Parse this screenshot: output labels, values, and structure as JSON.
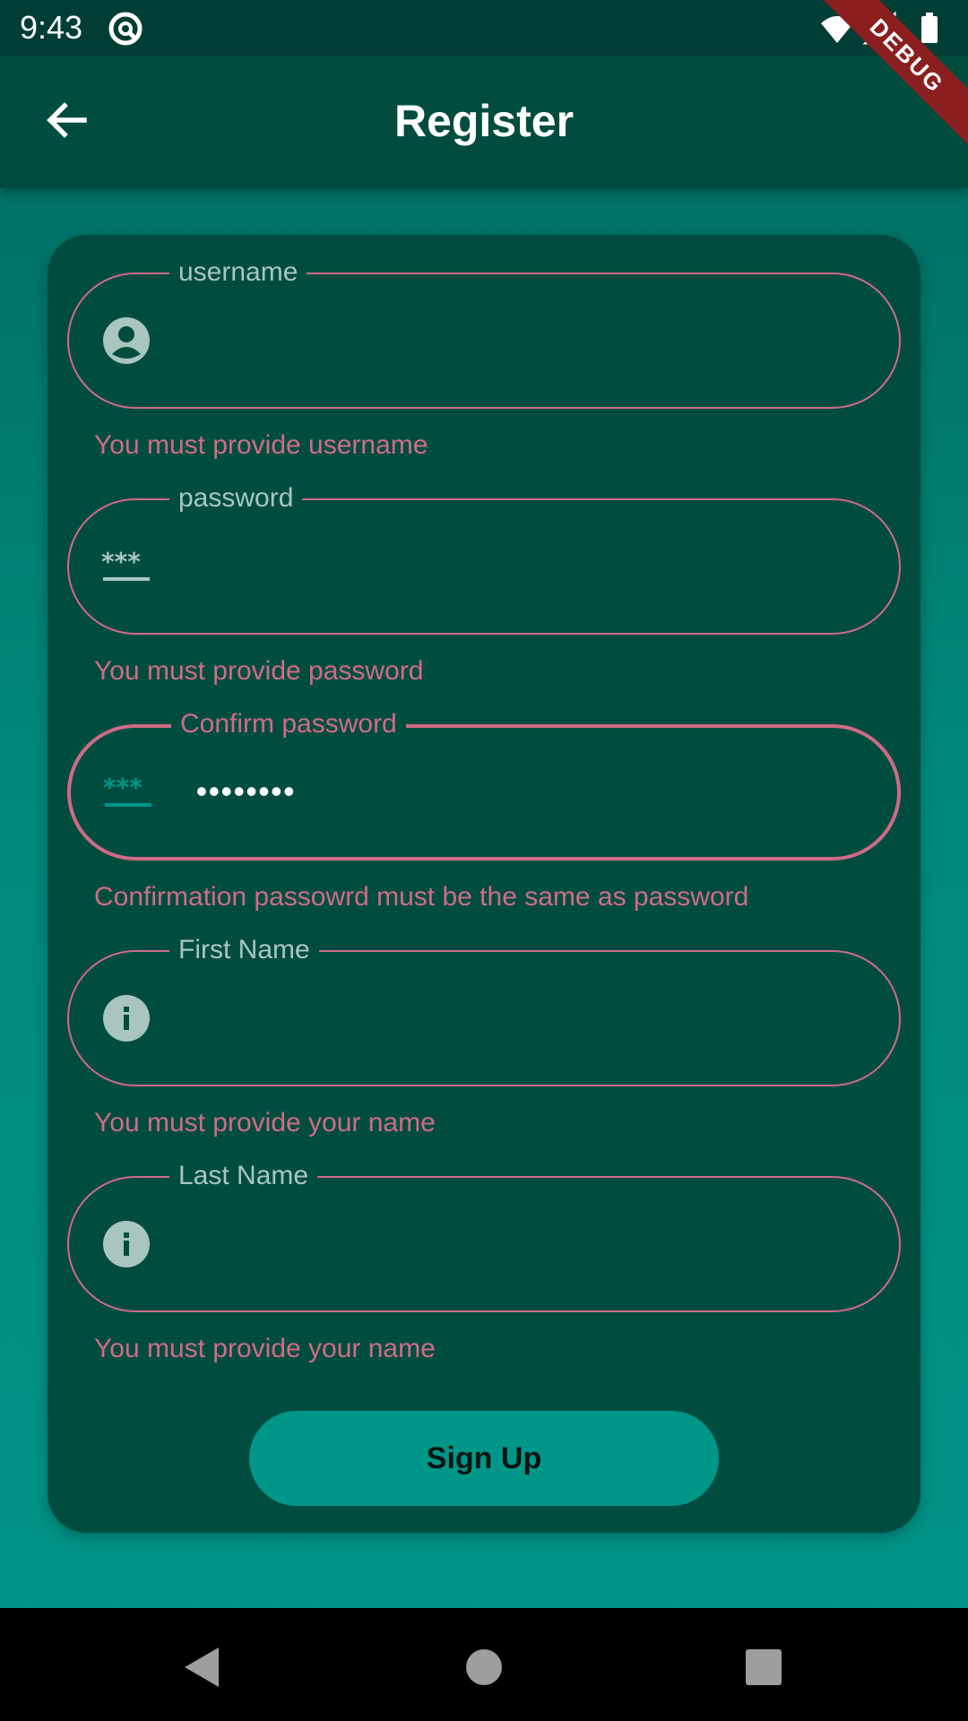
{
  "status_bar": {
    "time": "9:43"
  },
  "debug_banner": "DEBUG",
  "app_bar": {
    "title": "Register"
  },
  "form": {
    "username": {
      "label": "username",
      "value": "",
      "error": "You must provide username"
    },
    "password": {
      "label": "password",
      "value": "",
      "error": "You must provide password"
    },
    "confirm_password": {
      "label": "Confirm password",
      "value": "••••••••",
      "error": "Confirmation passowrd must be the same as password"
    },
    "first_name": {
      "label": "First Name",
      "value": "",
      "error": "You must provide your name"
    },
    "last_name": {
      "label": "Last Name",
      "value": "",
      "error": "You must provide your name"
    },
    "submit_label": "Sign Up"
  },
  "icons": {
    "back": "arrow-back-icon",
    "username": "account-circle-icon",
    "password": "password-icon",
    "name": "info-icon"
  },
  "colors": {
    "background": "#00897b",
    "card": "#004d40",
    "app_bar": "#004d40",
    "error": "#d06b86",
    "button": "#009688",
    "label": "#a9c5bf"
  }
}
